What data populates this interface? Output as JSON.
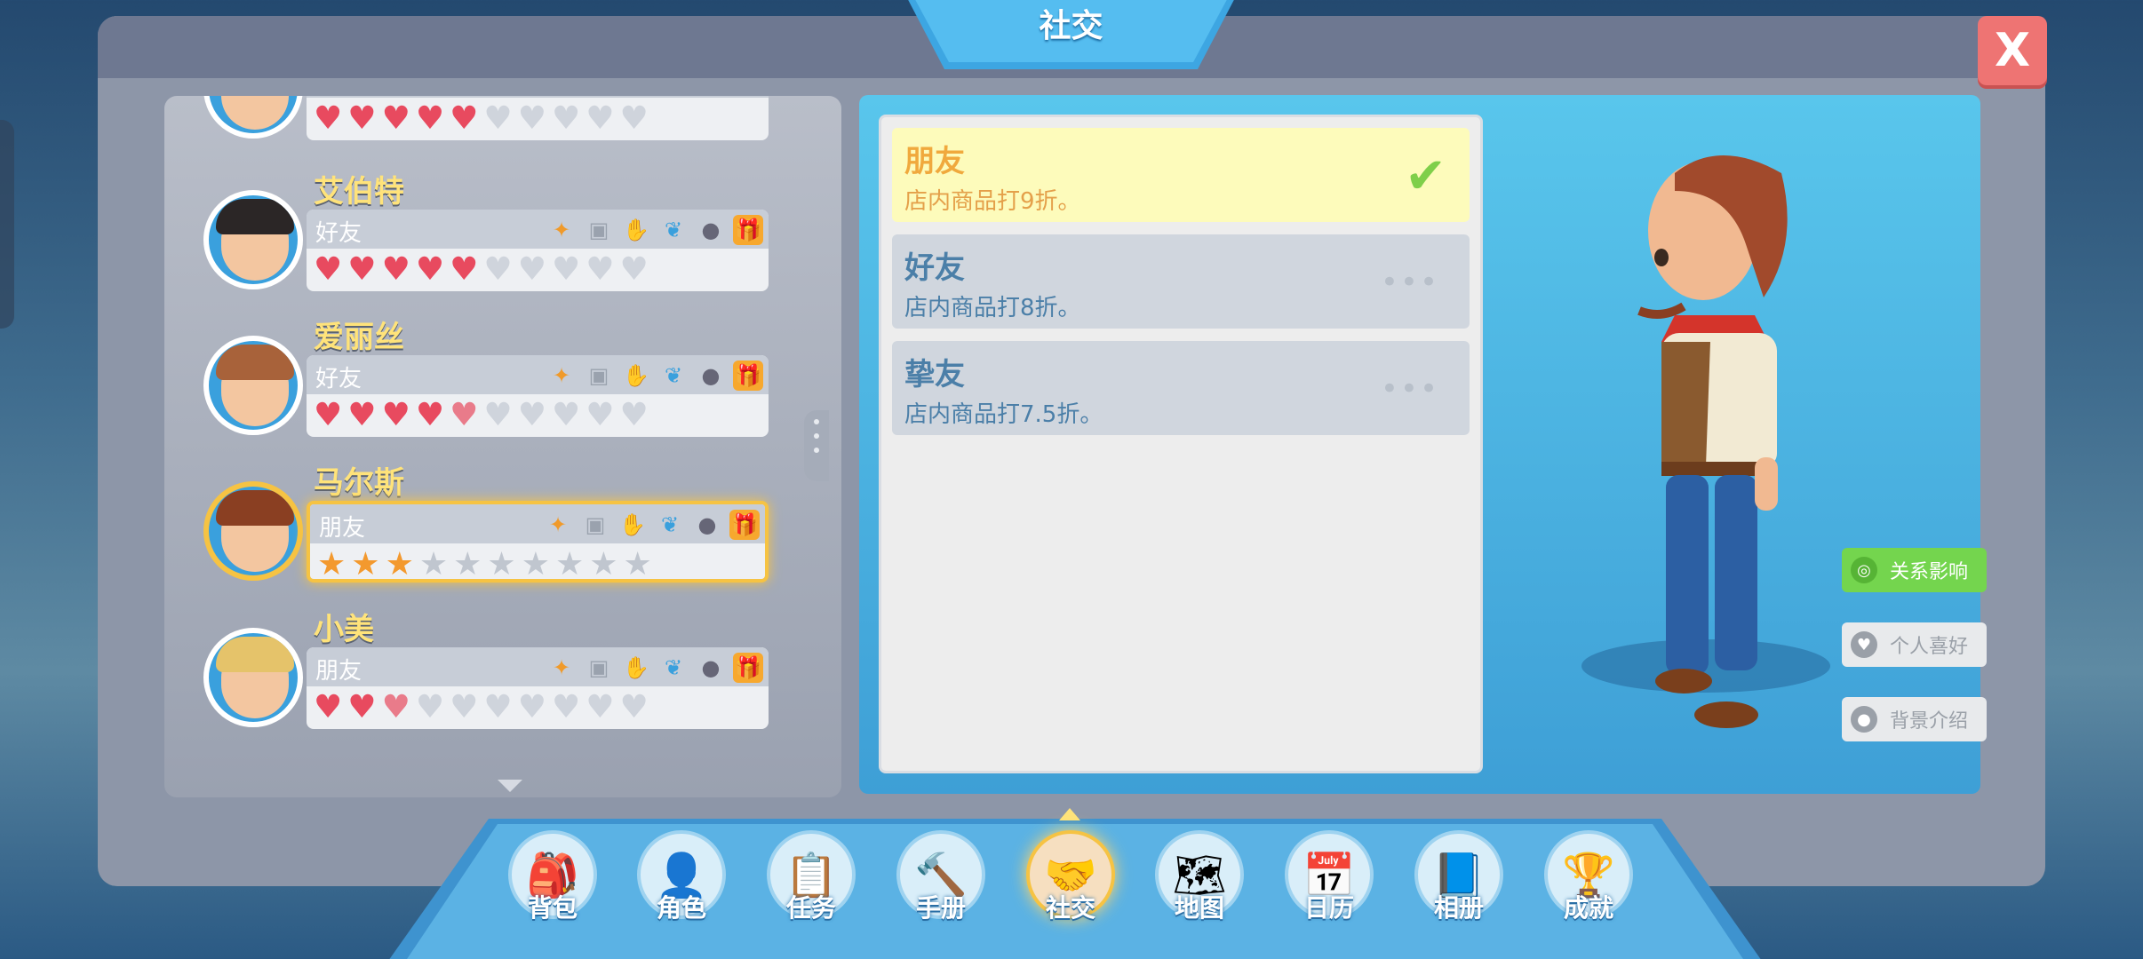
{
  "window": {
    "title": "社交",
    "close_label": "X"
  },
  "friends": [
    {
      "name": "",
      "relation": "",
      "hearts_filled": 5,
      "hearts_total": 10,
      "partial": false,
      "selected": false,
      "rating_type": "hearts"
    },
    {
      "name": "艾伯特",
      "relation": "好友",
      "hearts_filled": 5,
      "hearts_total": 10,
      "partial": false,
      "selected": false,
      "rating_type": "hearts"
    },
    {
      "name": "爱丽丝",
      "relation": "好友",
      "hearts_filled": 4.5,
      "hearts_total": 10,
      "partial": true,
      "selected": false,
      "rating_type": "hearts"
    },
    {
      "name": "马尔斯",
      "relation": "朋友",
      "hearts_filled": 3,
      "hearts_total": 10,
      "partial": false,
      "selected": true,
      "rating_type": "stars"
    },
    {
      "name": "小美",
      "relation": "朋友",
      "hearts_filled": 2.5,
      "hearts_total": 10,
      "partial": true,
      "selected": false,
      "rating_type": "hearts"
    }
  ],
  "levels": [
    {
      "title": "朋友",
      "desc": "店内商品打9折。",
      "active": true
    },
    {
      "title": "好友",
      "desc": "店内商品打8折。",
      "active": false
    },
    {
      "title": "挚友",
      "desc": "店内商品打7.5折。",
      "active": false
    }
  ],
  "side_buttons": [
    {
      "label": "关系影响",
      "icon": "relation-icon",
      "active": true
    },
    {
      "label": "个人喜好",
      "icon": "heart-icon",
      "active": false
    },
    {
      "label": "背景介绍",
      "icon": "person-icon",
      "active": false
    }
  ],
  "nav": [
    {
      "label": "背包",
      "icon": "backpack-icon",
      "glyph": "🎒",
      "active": false
    },
    {
      "label": "角色",
      "icon": "character-icon",
      "glyph": "👤",
      "active": false
    },
    {
      "label": "任务",
      "icon": "task-icon",
      "glyph": "📋",
      "active": false
    },
    {
      "label": "手册",
      "icon": "hammer-icon",
      "glyph": "🔨",
      "active": false
    },
    {
      "label": "社交",
      "icon": "handshake-icon",
      "glyph": "🤝",
      "active": true
    },
    {
      "label": "地图",
      "icon": "map-icon",
      "glyph": "🗺",
      "active": false
    },
    {
      "label": "日历",
      "icon": "calendar-icon",
      "glyph": "📅",
      "active": false
    },
    {
      "label": "相册",
      "icon": "album-icon",
      "glyph": "📘",
      "active": false
    },
    {
      "label": "成就",
      "icon": "trophy-icon",
      "glyph": "🏆",
      "active": false
    }
  ],
  "colors": {
    "heart": "#e84a5f",
    "star": "#f3992e",
    "accent_blue": "#3aa0dd",
    "gold": "#f6c343"
  }
}
